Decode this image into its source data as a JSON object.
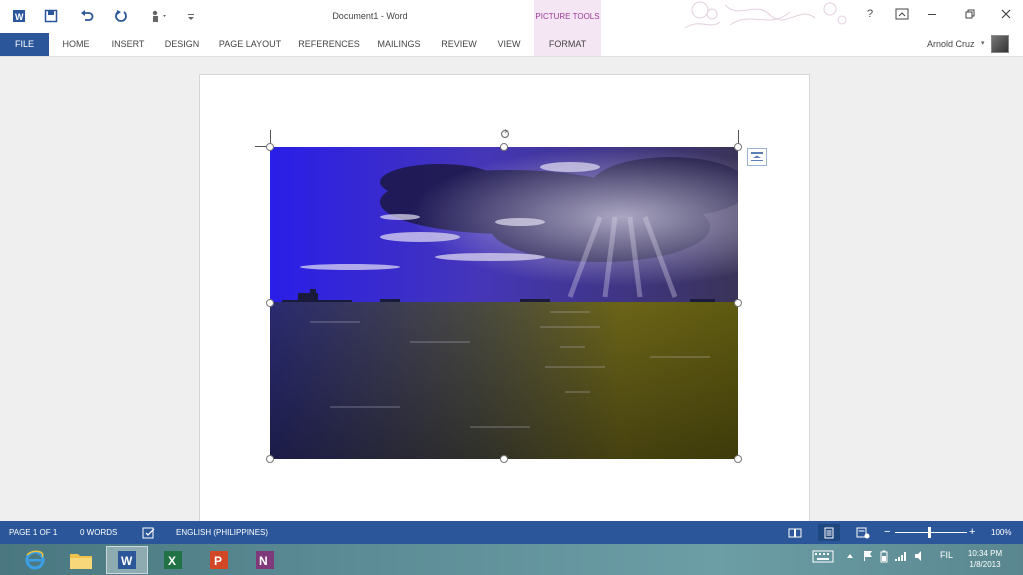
{
  "titlebar": {
    "title": "Document1 - Word",
    "help": "?"
  },
  "contextual_tab_group": {
    "label": "PICTURE TOOLS"
  },
  "ribbon": {
    "tabs": [
      {
        "label": "FILE"
      },
      {
        "label": "HOME"
      },
      {
        "label": "INSERT"
      },
      {
        "label": "DESIGN"
      },
      {
        "label": "PAGE LAYOUT"
      },
      {
        "label": "REFERENCES"
      },
      {
        "label": "MAILINGS"
      },
      {
        "label": "REVIEW"
      },
      {
        "label": "VIEW"
      },
      {
        "label": "FORMAT"
      }
    ],
    "user": "Arnold Cruz"
  },
  "statusbar": {
    "page": "PAGE 1 OF 1",
    "words": "0 WORDS",
    "language": "ENGLISH (PHILIPPINES)",
    "zoom": "100%",
    "zoom_slider_level_percent": 100
  },
  "taskbar": {
    "apps": [
      "internet-explorer",
      "file-explorer",
      "word",
      "excel",
      "powerpoint",
      "onenote"
    ],
    "language": "FIL",
    "time": "10:34 PM",
    "date": "1/8/2013"
  },
  "colors": {
    "accent": "#2b579a",
    "contextual": "#9e3a99",
    "contextual_bg": "#f5e6f4"
  }
}
